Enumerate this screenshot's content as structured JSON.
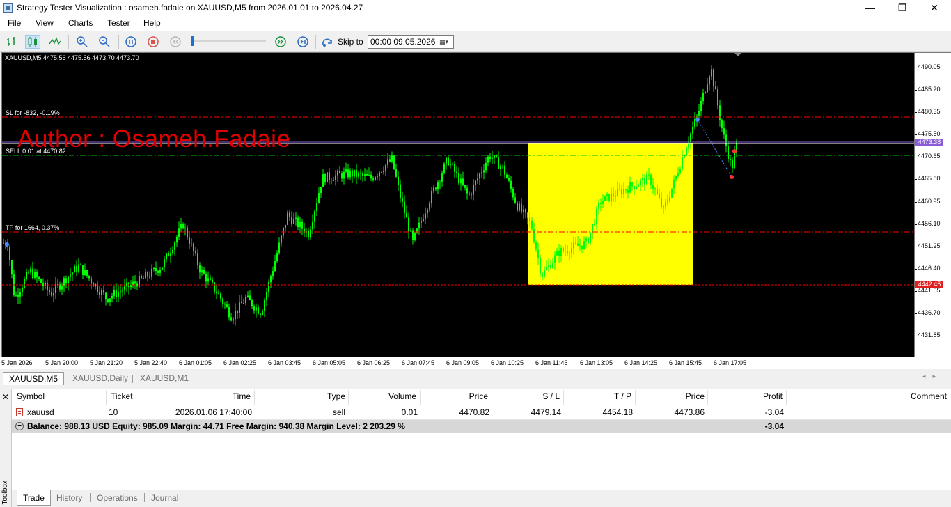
{
  "window": {
    "title": "Strategy Tester Visualization : osameh.fadaie on XAUUSD,M5 from 2026.01.01 to 2026.04.27",
    "minimize": "—",
    "maximize": "❐",
    "close": "✕"
  },
  "menu": [
    "File",
    "View",
    "Charts",
    "Tester",
    "Help"
  ],
  "toolbar": {
    "skip_label": "Skip to",
    "skip_value": "00:00 09.05.2026",
    "icons": [
      "bar-chart-icon",
      "candlestick-icon",
      "line-chart-icon",
      "zoom-in-icon",
      "zoom-out-icon",
      "pause-icon",
      "stop-icon",
      "slow-down-icon",
      "speed-slider",
      "fast-forward-icon",
      "step-forward-icon",
      "skip-to-icon"
    ]
  },
  "chart": {
    "symbol_info": "XAUUSD,M5  4475.56 4475.56 4473.70 4473.70",
    "author": "Author : Osameh.Fadaie",
    "sl_label": "SL for -832, -0.19%",
    "sell_label": "SELL 0.01 at 4470.82",
    "tp_label": "TP for 1664, 0.37%",
    "price_ticks": [
      "4490.05",
      "4485.20",
      "4480.35",
      "4475.50",
      "4470.65",
      "4465.80",
      "4460.95",
      "4456.10",
      "4451.25",
      "4446.40",
      "4441.55",
      "4436.70",
      "4431.85"
    ],
    "time_ticks": [
      "5 Jan 2026",
      "5 Jan 20:00",
      "5 Jan 21:20",
      "5 Jan 22:40",
      "6 Jan 01:05",
      "6 Jan 02:25",
      "6 Jan 03:45",
      "6 Jan 05:05",
      "6 Jan 06:25",
      "6 Jan 07:45",
      "6 Jan 09:05",
      "6 Jan 10:25",
      "6 Jan 11:45",
      "6 Jan 13:05",
      "6 Jan 14:25",
      "6 Jan 15:45",
      "6 Jan 17:05"
    ],
    "current_price_badge": "4473.38",
    "range_low_badge": "4442.45",
    "colors": {
      "background": "#000000",
      "candles": "#00ff00",
      "box": "#ffff00",
      "sl_tp": "#ff0000",
      "entry": "#00c000",
      "current": "#8a5cd8"
    }
  },
  "chart_tabs": [
    "XAUUSD,M5",
    "XAUUSD,Daily",
    "XAUUSD,M1"
  ],
  "trade_table": {
    "headers": [
      "Symbol",
      "Ticket",
      "Time",
      "Type",
      "Volume",
      "Price",
      "S / L",
      "T / P",
      "Price",
      "Profit",
      "Comment"
    ],
    "rows": [
      [
        "xauusd",
        "10",
        "2026.01.06 17:40:00",
        "sell",
        "0.01",
        "4470.82",
        "4479.14",
        "4454.18",
        "4473.86",
        "-3.04",
        ""
      ]
    ],
    "balance_text": "Balance: 988.13 USD  Equity: 985.09  Margin: 44.71  Free Margin: 940.38  Margin Level: 2 203.29 %",
    "balance_profit": "-3.04"
  },
  "toolbox": {
    "label": "Toolbox",
    "close": "✕",
    "tabs": [
      "Trade",
      "History",
      "Operations",
      "Journal"
    ]
  }
}
